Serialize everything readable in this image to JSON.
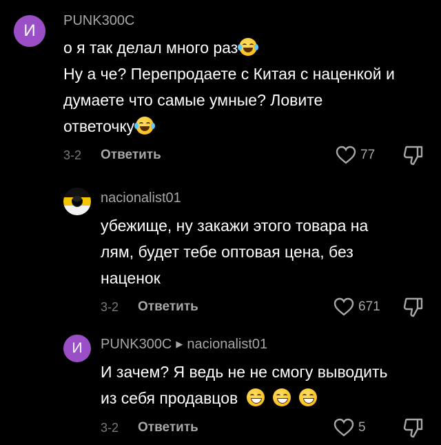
{
  "comments": [
    {
      "avatar_letter": "И",
      "author": "PUNK300C",
      "lines": [
        "о я так делал много раз",
        "Ну а че? Перепродаете с Китая с наценкой и",
        "думаете что самые умные? Ловите",
        "ответочку"
      ],
      "time": "3-2",
      "reply_label": "Ответить",
      "likes": "77"
    },
    {
      "author": "nacionalist01",
      "lines": [
        "убежище, ну закажи этого товара на",
        "лям, будет тебе оптовая цена, без",
        "наценок"
      ],
      "time": "3-2",
      "reply_label": "Ответить",
      "likes": "671"
    },
    {
      "avatar_letter": "И",
      "author": "PUNK300C",
      "reply_to": "nacionalist01",
      "lines": [
        "И зачем? Я ведь не не смогу выводить",
        "из себя продавцов"
      ],
      "time": "3-2",
      "reply_label": "Ответить",
      "likes": "5"
    }
  ],
  "icons": {
    "like": "heart-outline-icon",
    "dislike": "thumb-down-icon",
    "laugh_emoji": "face-with-tears-of-joy",
    "grin_emoji": "grinning-face-with-smiling-eyes"
  },
  "colors": {
    "background": "#000000",
    "avatar_purple": "#9a4fc7",
    "secondary_text": "#a8a8a8"
  }
}
